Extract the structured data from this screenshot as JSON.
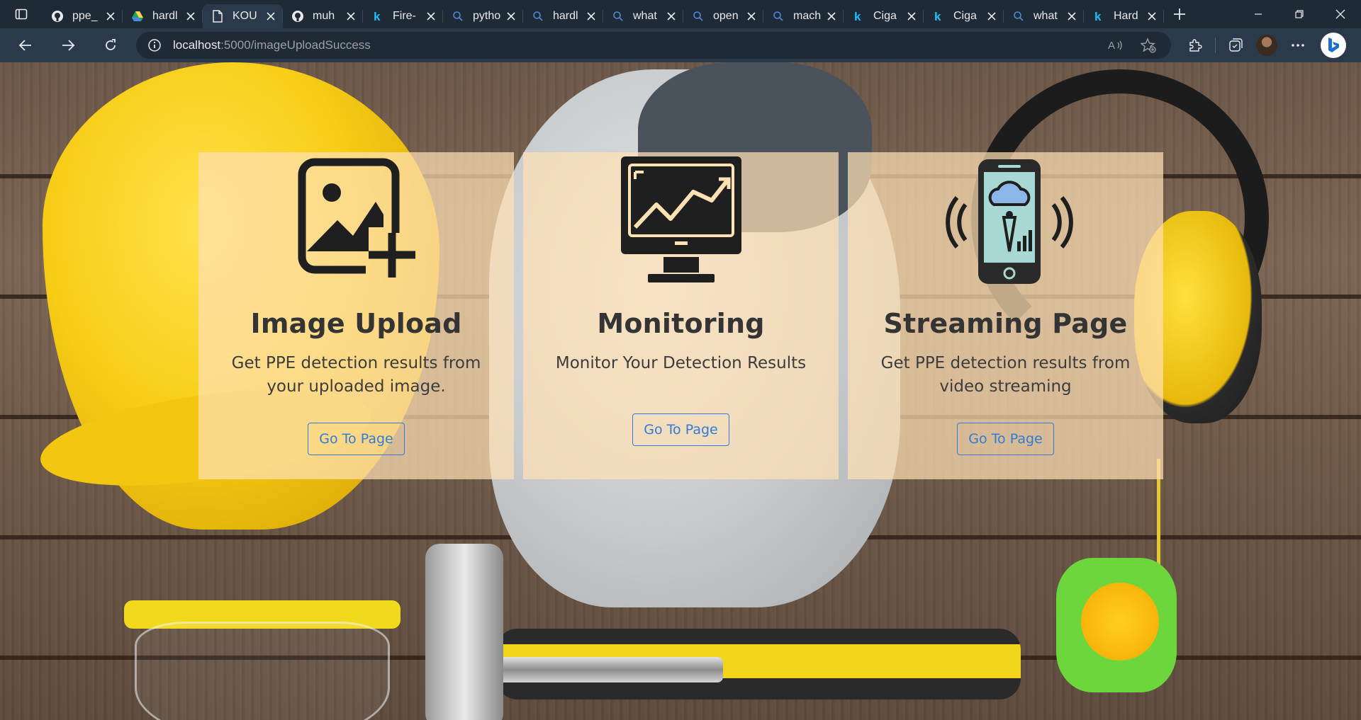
{
  "browser": {
    "tabs": [
      {
        "label": "ppe_",
        "icon": "github-icon",
        "active": false
      },
      {
        "label": "hardl",
        "icon": "google-drive-icon",
        "active": false
      },
      {
        "label": "KOU",
        "icon": "document-icon",
        "active": true
      },
      {
        "label": "muh",
        "icon": "github-icon",
        "active": false
      },
      {
        "label": "Fire-",
        "icon": "kaggle-icon",
        "active": false
      },
      {
        "label": "pytho",
        "icon": "search-icon",
        "active": false
      },
      {
        "label": "hardl",
        "icon": "search-icon",
        "active": false
      },
      {
        "label": "what",
        "icon": "search-icon",
        "active": false
      },
      {
        "label": "open",
        "icon": "search-icon",
        "active": false
      },
      {
        "label": "mach",
        "icon": "search-icon",
        "active": false
      },
      {
        "label": "Ciga",
        "icon": "kaggle-icon",
        "active": false
      },
      {
        "label": "Ciga",
        "icon": "kaggle-icon",
        "active": false
      },
      {
        "label": "what",
        "icon": "search-icon",
        "active": false
      },
      {
        "label": "Hard",
        "icon": "kaggle-icon",
        "active": false
      }
    ],
    "url": {
      "host": "localhost",
      "path": ":5000/imageUploadSuccess"
    }
  },
  "cards": [
    {
      "title": "Image Upload",
      "description": "Get PPE detection results from your uploaded image.",
      "button": "Go To Page",
      "icon": "image-add-icon"
    },
    {
      "title": "Monitoring",
      "description": "Monitor Your Detection Results",
      "button": "Go To Page",
      "icon": "monitor-chart-icon"
    },
    {
      "title": "Streaming Page",
      "description": "Get PPE detection results from video streaming",
      "button": "Go To Page",
      "icon": "phone-streaming-icon"
    }
  ],
  "colors": {
    "card_background": "#ffe1b4",
    "button_accent": "#2f7bd6",
    "title_text": "#343434",
    "browser_frame": "#1f2a37"
  }
}
